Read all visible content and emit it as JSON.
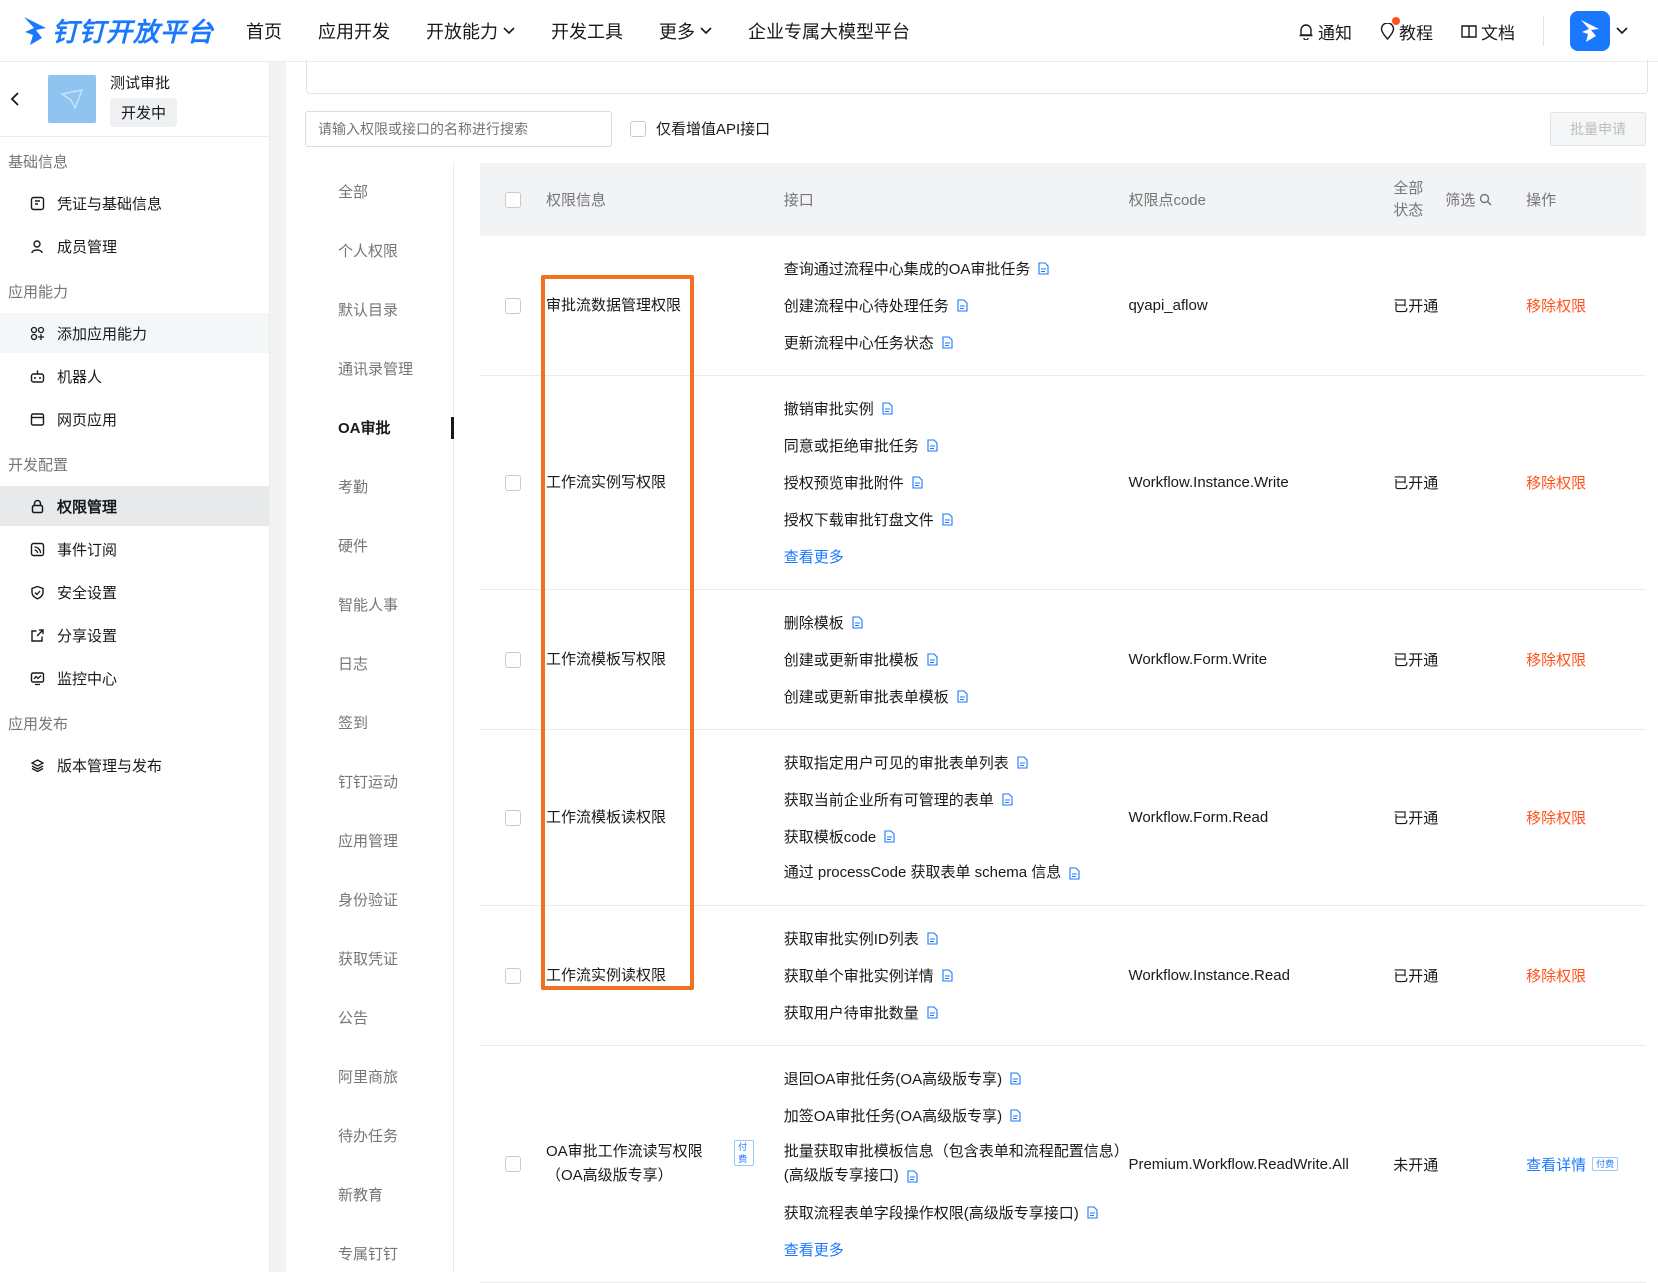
{
  "brand": {
    "name": "钉钉开放平台",
    "accent": "#1a78ff"
  },
  "nav": [
    {
      "label": "首页",
      "dropdown": false
    },
    {
      "label": "应用开发",
      "dropdown": false
    },
    {
      "label": "开放能力",
      "dropdown": true
    },
    {
      "label": "开发工具",
      "dropdown": false
    },
    {
      "label": "更多",
      "dropdown": true
    },
    {
      "label": "企业专属大模型平台",
      "dropdown": false
    }
  ],
  "top_right": {
    "notify": "通知",
    "tutorial": "教程",
    "docs": "文档"
  },
  "app": {
    "name": "测试审批",
    "status": "开发中"
  },
  "sidebar": {
    "groups": [
      {
        "title": "基础信息",
        "items": [
          {
            "label": "凭证与基础信息",
            "icon": "credential-icon"
          },
          {
            "label": "成员管理",
            "icon": "user-icon"
          }
        ]
      },
      {
        "title": "应用能力",
        "items": [
          {
            "label": "添加应用能力",
            "icon": "grid-icon"
          },
          {
            "label": "机器人",
            "icon": "robot-icon"
          },
          {
            "label": "网页应用",
            "icon": "browser-icon"
          }
        ]
      },
      {
        "title": "开发配置",
        "items": [
          {
            "label": "权限管理",
            "icon": "lock-icon"
          },
          {
            "label": "事件订阅",
            "icon": "rss-icon"
          },
          {
            "label": "安全设置",
            "icon": "shield-icon"
          },
          {
            "label": "分享设置",
            "icon": "share-icon"
          },
          {
            "label": "监控中心",
            "icon": "monitor-icon"
          }
        ]
      },
      {
        "title": "应用发布",
        "items": [
          {
            "label": "版本管理与发布",
            "icon": "layers-icon"
          }
        ]
      }
    ]
  },
  "toolbar": {
    "search_placeholder": "请输入权限或接口的名称进行搜索",
    "only_value_added": "仅看增值API接口",
    "batch_apply": "批量申请"
  },
  "categories": [
    "全部",
    "个人权限",
    "默认目录",
    "通讯录管理",
    "OA审批",
    "考勤",
    "硬件",
    "智能人事",
    "日志",
    "签到",
    "钉钉运动",
    "应用管理",
    "身份验证",
    "获取凭证",
    "公告",
    "阿里商旅",
    "待办任务",
    "新教育",
    "专属钉钉"
  ],
  "active_category": "OA审批",
  "table": {
    "headers": {
      "perm": "权限信息",
      "api": "接口",
      "code": "权限点code",
      "state_line1": "全部",
      "state_line2": "状态",
      "filter": "筛选",
      "op": "操作"
    },
    "rows": [
      {
        "perm": "审批流数据管理权限",
        "apis": [
          "查询通过流程中心集成的OA审批任务",
          "创建流程中心待处理任务",
          "更新流程中心任务状态"
        ],
        "more": "",
        "code": "qyapi_aflow",
        "state": "已开通",
        "op": "移除权限",
        "op_type": "red"
      },
      {
        "perm": "工作流实例写权限",
        "apis": [
          "撤销审批实例",
          "同意或拒绝审批任务",
          "授权预览审批附件",
          "授权下载审批钉盘文件"
        ],
        "more": "查看更多",
        "code": "Workflow.Instance.Write",
        "state": "已开通",
        "op": "移除权限",
        "op_type": "red"
      },
      {
        "perm": "工作流模板写权限",
        "apis": [
          "删除模板",
          "创建或更新审批模板",
          "创建或更新审批表单模板"
        ],
        "more": "",
        "code": "Workflow.Form.Write",
        "state": "已开通",
        "op": "移除权限",
        "op_type": "red"
      },
      {
        "perm": "工作流模板读权限",
        "apis": [
          "获取指定用户可见的审批表单列表",
          "获取当前企业所有可管理的表单",
          "获取模板code",
          "通过 processCode 获取表单 schema 信息"
        ],
        "more": "",
        "code": "Workflow.Form.Read",
        "state": "已开通",
        "op": "移除权限",
        "op_type": "red"
      },
      {
        "perm": "工作流实例读权限",
        "apis": [
          "获取审批实例ID列表",
          "获取单个审批实例详情",
          "获取用户待审批数量"
        ],
        "more": "",
        "code": "Workflow.Instance.Read",
        "state": "已开通",
        "op": "移除权限",
        "op_type": "red"
      },
      {
        "perm": "OA审批工作流读写权限（OA高级版专享）",
        "paid": "付费",
        "apis": [
          "退回OA审批任务(OA高级版专享)",
          "加签OA审批任务(OA高级版专享)",
          "批量获取审批模板信息（包含表单和流程配置信息）(高级版专享接口)",
          "获取流程表单字段操作权限(高级版专享接口)"
        ],
        "more": "查看更多",
        "code": "Premium.Workflow.ReadWrite.All",
        "state": "未开通",
        "op": "查看详情",
        "op_type": "blue"
      }
    ]
  },
  "highlight_color": "#f0711f"
}
